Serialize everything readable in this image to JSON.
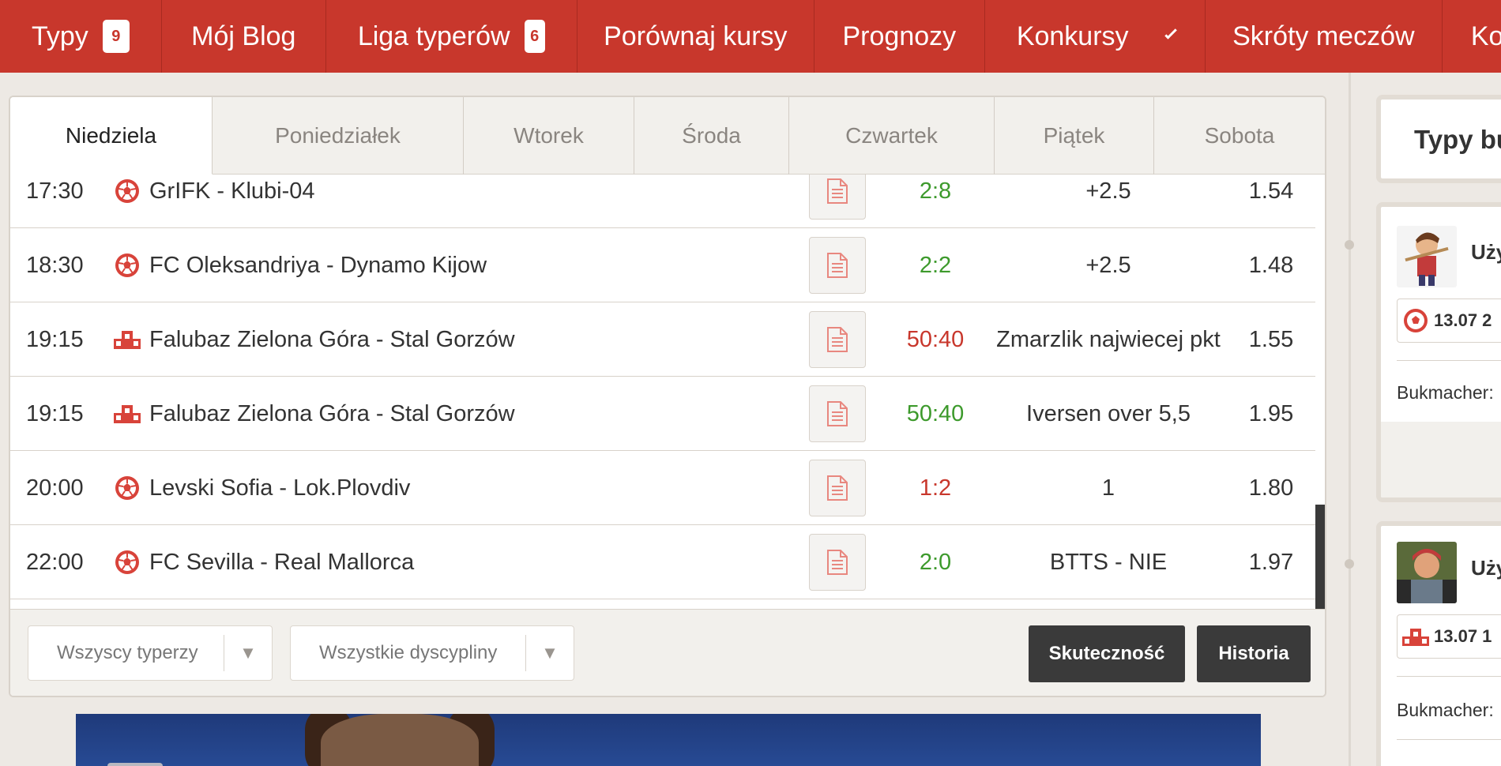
{
  "nav": {
    "items": [
      {
        "label": "Typy",
        "badge": "9"
      },
      {
        "label": "Mój Blog",
        "badge": ""
      },
      {
        "label": "Liga typerów",
        "badge": "6"
      },
      {
        "label": "Porównaj kursy",
        "badge": ""
      },
      {
        "label": "Prognozy",
        "badge": ""
      },
      {
        "label": "Konkursy",
        "badge": ""
      },
      {
        "label": "Skróty meczów",
        "badge": ""
      },
      {
        "label": "Ko",
        "badge": ""
      }
    ]
  },
  "days": [
    "Niedziela",
    "Poniedziałek",
    "Wtorek",
    "Środa",
    "Czwartek",
    "Piątek",
    "Sobota"
  ],
  "tips": [
    {
      "time": "17:30",
      "sport": "football",
      "match": "GrIFK - Klubi-04",
      "score": "2:8",
      "result": "win",
      "pick": "+2.5",
      "odds": "1.54"
    },
    {
      "time": "18:30",
      "sport": "football",
      "match": "FC Oleksandriya - Dynamo Kijow",
      "score": "2:2",
      "result": "win",
      "pick": "+2.5",
      "odds": "1.48"
    },
    {
      "time": "19:15",
      "sport": "speedway",
      "match": "Falubaz Zielona Góra - Stal Gorzów",
      "score": "50:40",
      "result": "loss",
      "pick": "Zmarzlik najwiecej pkt",
      "odds": "1.55"
    },
    {
      "time": "19:15",
      "sport": "speedway",
      "match": "Falubaz Zielona Góra - Stal Gorzów",
      "score": "50:40",
      "result": "win",
      "pick": "Iversen over 5,5",
      "odds": "1.95"
    },
    {
      "time": "20:00",
      "sport": "football",
      "match": "Levski Sofia - Lok.Plovdiv",
      "score": "1:2",
      "result": "loss",
      "pick": "1",
      "odds": "1.80"
    },
    {
      "time": "22:00",
      "sport": "football",
      "match": "FC Sevilla - Real Mallorca",
      "score": "2:0",
      "result": "win",
      "pick": "BTTS - NIE",
      "odds": "1.97"
    }
  ],
  "filters": {
    "tipsters": "Wszyscy typerzy",
    "disciplines": "Wszystkie dyscypliny",
    "effectiveness_btn": "Skuteczność",
    "history_btn": "Historia"
  },
  "sidebar": {
    "title": "Typy bu",
    "cards": [
      {
        "user": "Uży",
        "date": "13.07 2",
        "bookmaker": "Bukmacher:"
      },
      {
        "user": "Uży",
        "date": "13.07 1",
        "bookmaker": "Bukmacher:"
      }
    ]
  },
  "colors": {
    "brand": "#c8372c",
    "win": "#3d9a2c",
    "loss": "#c8372c",
    "dark_button": "#3a3a3a"
  }
}
